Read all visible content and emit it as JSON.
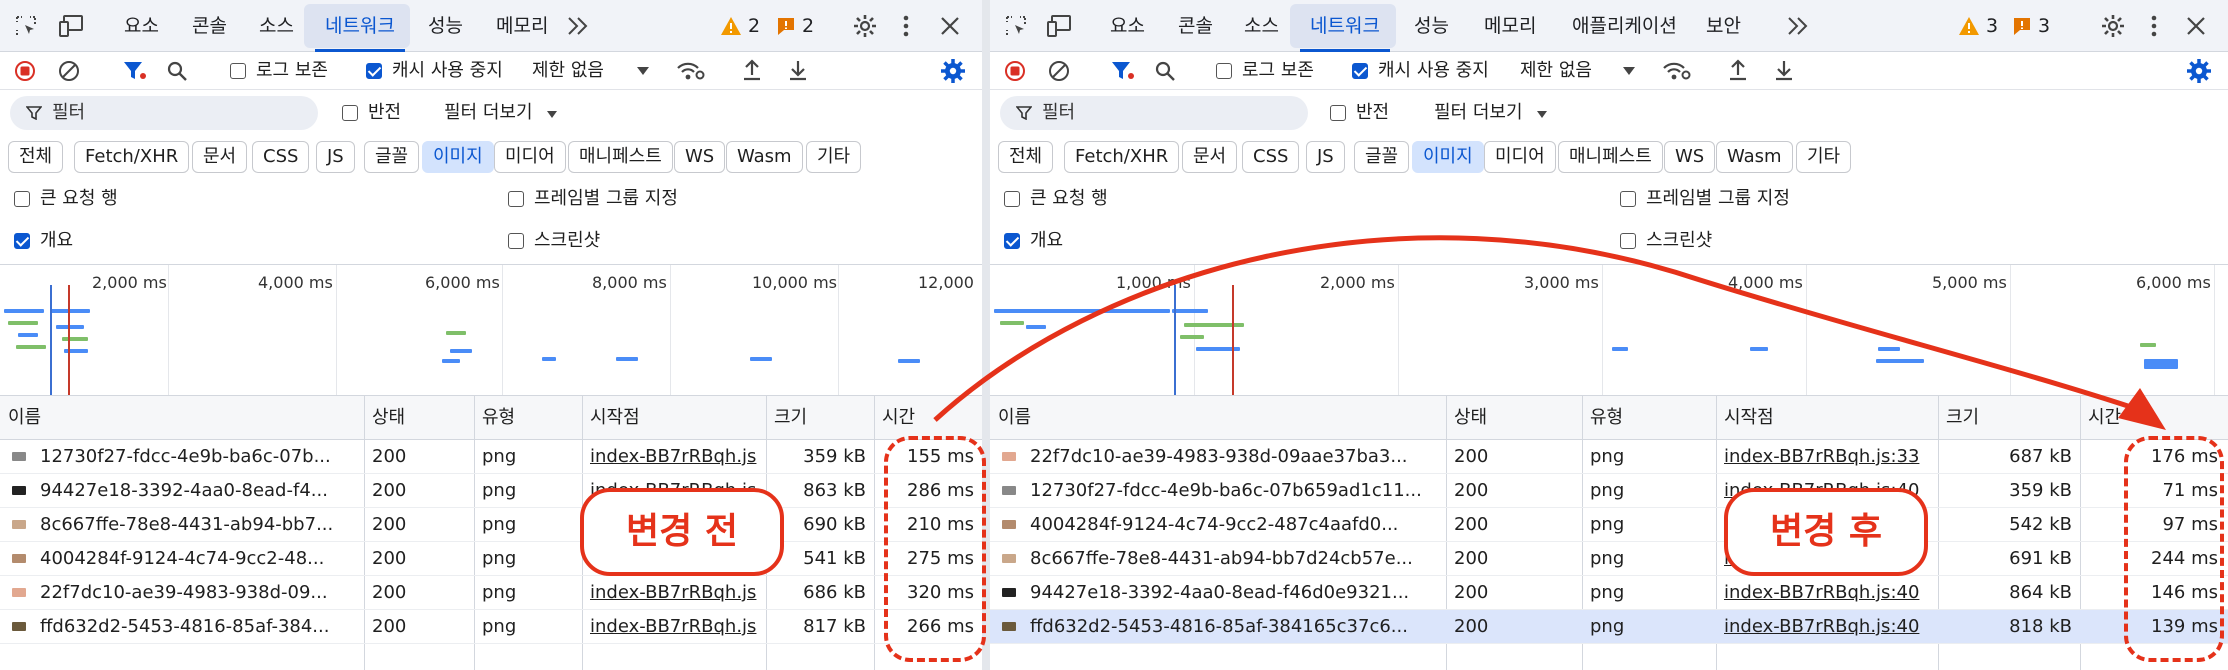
{
  "left": {
    "tabs": [
      "요소",
      "콘솔",
      "소스",
      "네트워크",
      "성능",
      "메모리"
    ],
    "active_tab": "네트워크",
    "warnings": "2",
    "issues": "2",
    "toolbar": {
      "preserve_log": "로그 보존",
      "disable_cache": "캐시 사용 중지",
      "throttle": "제한 없음"
    },
    "filter_placeholder": "필터",
    "invert": "반전",
    "more_filters": "필터 더보기",
    "types": [
      "전체",
      "Fetch/XHR",
      "문서",
      "CSS",
      "JS",
      "글꼴",
      "이미지",
      "미디어",
      "매니페스트",
      "WS",
      "Wasm",
      "기타"
    ],
    "active_type": "이미지",
    "options": {
      "big_rows": "큰 요청 행",
      "group_by_frame": "프레임별 그룹 지정",
      "overview": "개요",
      "screenshots": "스크린샷"
    },
    "ticks": [
      "2,000 ms",
      "4,000 ms",
      "6,000 ms",
      "8,000 ms",
      "10,000 ms",
      "12,000"
    ],
    "columns": [
      "이름",
      "상태",
      "유형",
      "시작점",
      "크기",
      "시간"
    ],
    "rows": [
      {
        "name": "12730f27-fdcc-4e9b-ba6c-07b...",
        "status": "200",
        "type": "png",
        "initiator": "index-BB7rRBqh.js",
        "size": "359 kB",
        "time": "155 ms",
        "thumb": "#888"
      },
      {
        "name": "94427e18-3392-4aa0-8ead-f4...",
        "status": "200",
        "type": "png",
        "initiator": "index-BB7rRBqh.js",
        "size": "863 kB",
        "time": "286 ms",
        "thumb": "#222"
      },
      {
        "name": "8c667ffe-78e8-4431-ab94-bb7...",
        "status": "200",
        "type": "png",
        "initiator": "index-BB7rRBqh.js",
        "size": "690 kB",
        "time": "210 ms",
        "thumb": "#c9a78a"
      },
      {
        "name": "4004284f-9124-4c74-9cc2-48...",
        "status": "200",
        "type": "png",
        "initiator": "index-BB7rRBqh.js",
        "size": "541 kB",
        "time": "275 ms",
        "thumb": "#b38b6d"
      },
      {
        "name": "22f7dc10-ae39-4983-938d-09...",
        "status": "200",
        "type": "png",
        "initiator": "index-BB7rRBqh.js",
        "size": "686 kB",
        "time": "320 ms",
        "thumb": "#e2a890"
      },
      {
        "name": "ffd632d2-5453-4816-85af-384...",
        "status": "200",
        "type": "png",
        "initiator": "index-BB7rRBqh.js",
        "size": "817 kB",
        "time": "266 ms",
        "thumb": "#6b5a3c"
      }
    ],
    "annotation": "변경 전"
  },
  "right": {
    "tabs": [
      "요소",
      "콘솔",
      "소스",
      "네트워크",
      "성능",
      "메모리",
      "애플리케이션",
      "보안"
    ],
    "active_tab": "네트워크",
    "warnings": "3",
    "issues": "3",
    "toolbar": {
      "preserve_log": "로그 보존",
      "disable_cache": "캐시 사용 중지",
      "throttle": "제한 없음"
    },
    "filter_placeholder": "필터",
    "invert": "반전",
    "more_filters": "필터 더보기",
    "types": [
      "전체",
      "Fetch/XHR",
      "문서",
      "CSS",
      "JS",
      "글꼴",
      "이미지",
      "미디어",
      "매니페스트",
      "WS",
      "Wasm",
      "기타"
    ],
    "active_type": "이미지",
    "options": {
      "big_rows": "큰 요청 행",
      "group_by_frame": "프레임별 그룹 지정",
      "overview": "개요",
      "screenshots": "스크린샷"
    },
    "ticks": [
      "1,000 ms",
      "2,000 ms",
      "3,000 ms",
      "4,000 ms",
      "5,000 ms",
      "6,000 ms"
    ],
    "columns": [
      "이름",
      "상태",
      "유형",
      "시작점",
      "크기",
      "시간"
    ],
    "rows": [
      {
        "name": "22f7dc10-ae39-4983-938d-09aae37ba3...",
        "status": "200",
        "type": "png",
        "initiator": "index-BB7rRBqh.js:33",
        "size": "687 kB",
        "time": "176 ms",
        "thumb": "#e2a890"
      },
      {
        "name": "12730f27-fdcc-4e9b-ba6c-07b659ad1c11...",
        "status": "200",
        "type": "png",
        "initiator": "index-BB7rRBqh.js:40",
        "size": "359 kB",
        "time": "71 ms",
        "thumb": "#888"
      },
      {
        "name": "4004284f-9124-4c74-9cc2-487c4aafd0...",
        "status": "200",
        "type": "png",
        "initiator": "index-BB7rRBqh.js:40",
        "size": "542 kB",
        "time": "97 ms",
        "thumb": "#b38b6d"
      },
      {
        "name": "8c667ffe-78e8-4431-ab94-bb7d24cb57e...",
        "status": "200",
        "type": "png",
        "initiator": "index-BB7rRBqh.js:40",
        "size": "691 kB",
        "time": "244 ms",
        "thumb": "#c9a78a"
      },
      {
        "name": "94427e18-3392-4aa0-8ead-f46d0e9321...",
        "status": "200",
        "type": "png",
        "initiator": "index-BB7rRBqh.js:40",
        "size": "864 kB",
        "time": "146 ms",
        "thumb": "#222"
      },
      {
        "name": "ffd632d2-5453-4816-85af-384165c37c6...",
        "status": "200",
        "type": "png",
        "initiator": "index-BB7rRBqh.js:40",
        "size": "818 kB",
        "time": "139 ms",
        "thumb": "#6b5a3c"
      }
    ],
    "selected_row": 5,
    "annotation": "변경 후"
  },
  "colors": {
    "accent": "#0b57d0",
    "record": "#d93025",
    "annotation": "#e5321a",
    "warning": "#f29900",
    "issue": "#e37400"
  }
}
